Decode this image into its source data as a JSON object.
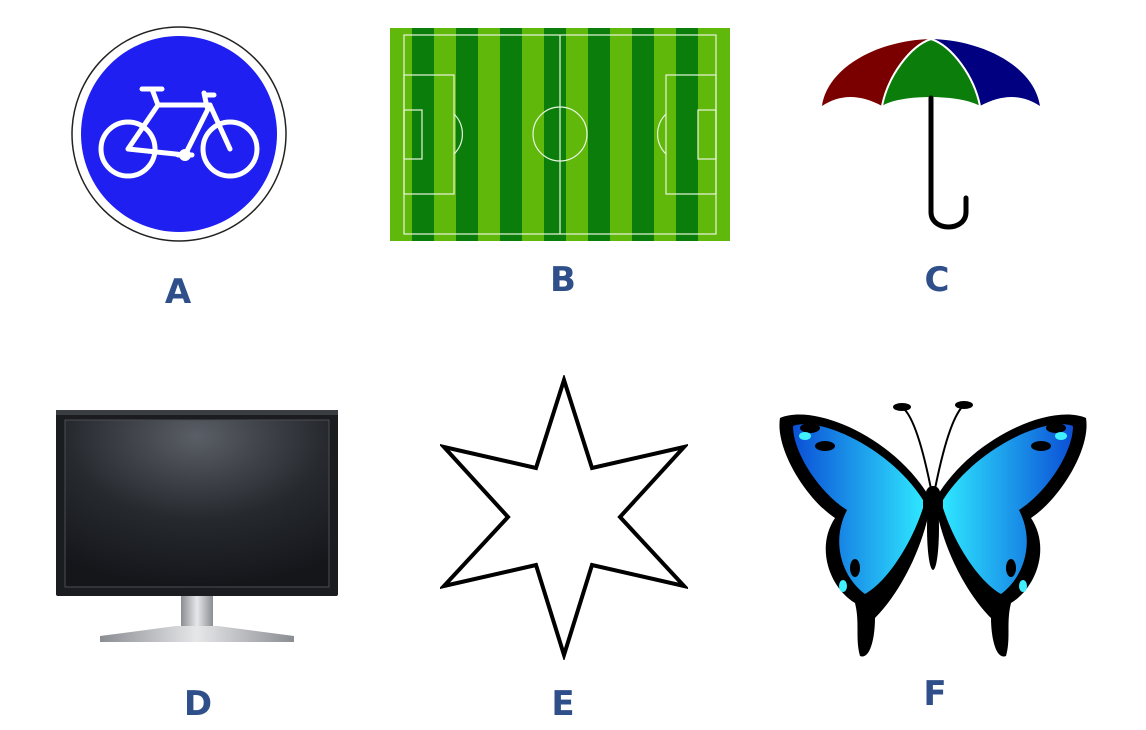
{
  "items": [
    {
      "label": "A",
      "icon": "bicycle-sign-icon"
    },
    {
      "label": "B",
      "icon": "soccer-field-icon"
    },
    {
      "label": "C",
      "icon": "umbrella-icon"
    },
    {
      "label": "D",
      "icon": "monitor-icon"
    },
    {
      "label": "E",
      "icon": "six-pointed-star-icon"
    },
    {
      "label": "F",
      "icon": "butterfly-icon"
    }
  ],
  "colors": {
    "label": "#2f4f8a",
    "sign_blue": "#1f1ff2",
    "field_dark": "#0a7d0a",
    "field_light": "#5fb80a",
    "umbrella_red": "#7a0000",
    "umbrella_green": "#0a7d0a",
    "umbrella_blue": "#000080",
    "butterfly_blue": "#1aa0ff"
  }
}
